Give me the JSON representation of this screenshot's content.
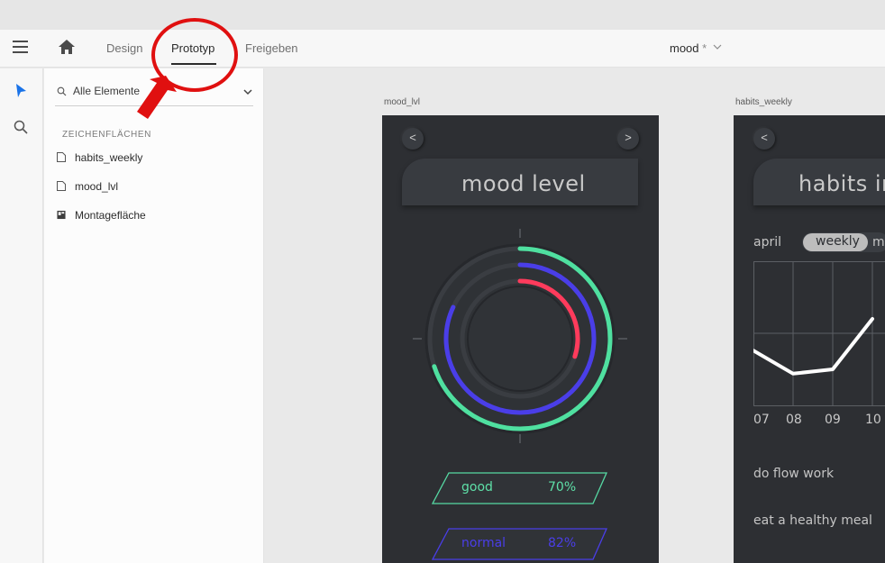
{
  "nav": {
    "tabs": [
      "Design",
      "Prototyp",
      "Freigeben"
    ],
    "doc_name": "mood",
    "unsaved_mark": "*"
  },
  "tools": [
    "select-arrow-icon",
    "search-icon"
  ],
  "layers": {
    "filter": "Alle Elemente",
    "section": "ZEICHENFLÄCHEN",
    "items": [
      "habits_weekly",
      "mood_lvl",
      "Montagefläche"
    ]
  },
  "canvas": {
    "boards": [
      {
        "label": "mood_lvl",
        "title": "mood level",
        "prev": "<",
        "next": ">",
        "stats": [
          {
            "label": "good",
            "value": "70%",
            "color": "#5ee0a8"
          },
          {
            "label": "normal",
            "value": "82%",
            "color": "#4a3ee8"
          }
        ],
        "rings": [
          {
            "name": "good",
            "fraction": 0.7,
            "color": "#4fe0a0"
          },
          {
            "name": "normal",
            "fraction": 0.82,
            "color": "#4a3ee8"
          },
          {
            "name": "bad",
            "fraction": 0.3,
            "color": "#ff3b5c"
          }
        ]
      },
      {
        "label": "habits_weekly",
        "title": "habits in",
        "prev": "<",
        "month": "april",
        "toggle": [
          "weekly",
          "m"
        ],
        "chart_ticks": [
          "07",
          "08",
          "09",
          "10"
        ],
        "chart_series": [
          0.38,
          0.22,
          0.25,
          0.6
        ],
        "habits": [
          "do flow work",
          "eat a healthy meal"
        ]
      }
    ]
  },
  "colors": {
    "accent": "#1a73e8",
    "annotation": "#e01010",
    "artboard_bg": "#2d2f33"
  }
}
